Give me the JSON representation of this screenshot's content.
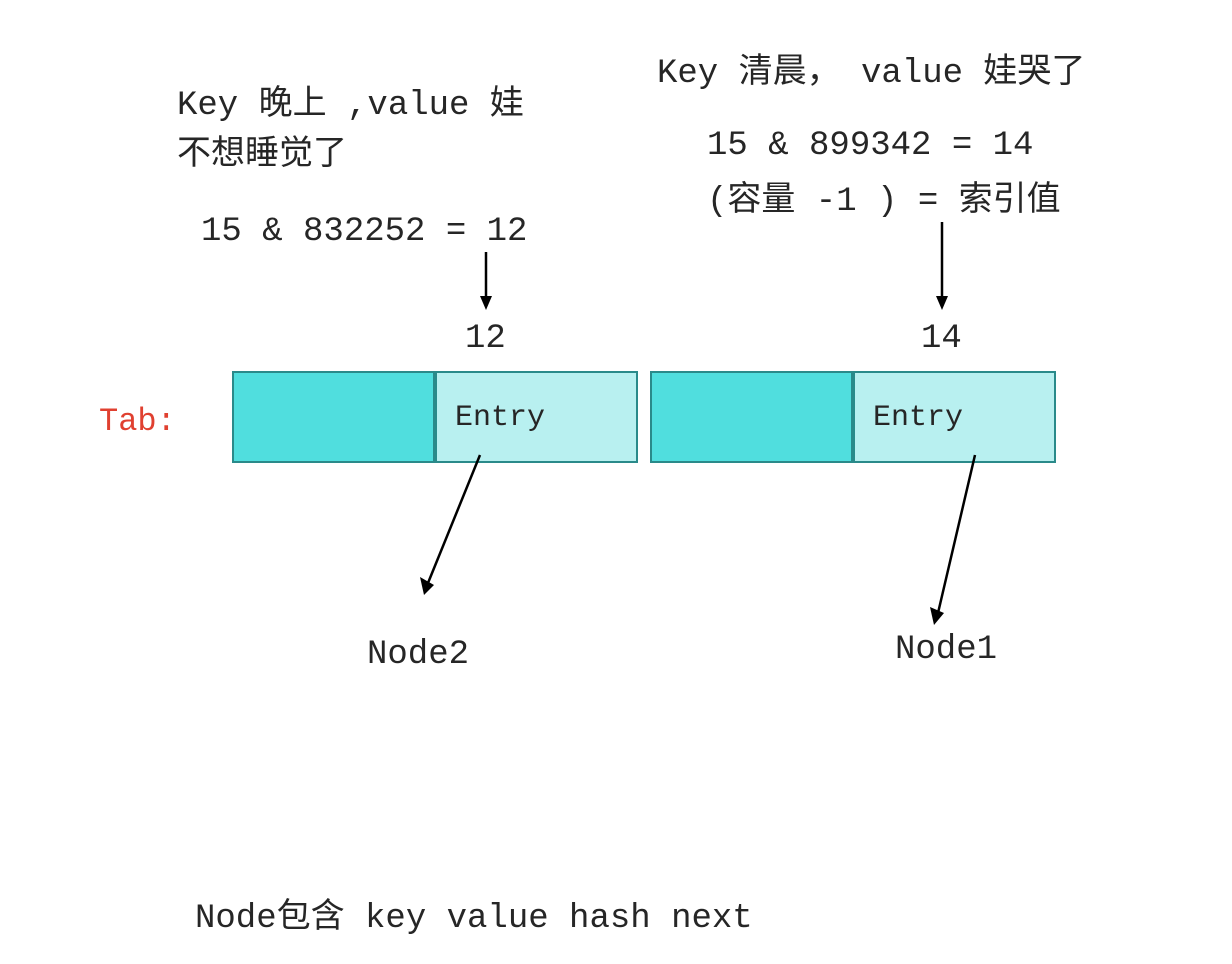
{
  "left": {
    "kv_line1": "Key 晚上 ,value 娃",
    "kv_line2": "不想睡觉了",
    "hash_expr": "15 & 832252 = 12",
    "index": "12",
    "entry_label": "Entry",
    "node_label": "Node2"
  },
  "right": {
    "kv_line1": "Key 清晨， value 娃哭了",
    "hash_expr": "15 & 899342 = 14",
    "formula": "(容量 -1 )  = 索引值",
    "index": "14",
    "entry_label": "Entry",
    "node_label": "Node1"
  },
  "tab_label": "Tab:",
  "footer": "Node包含  key value hash next"
}
